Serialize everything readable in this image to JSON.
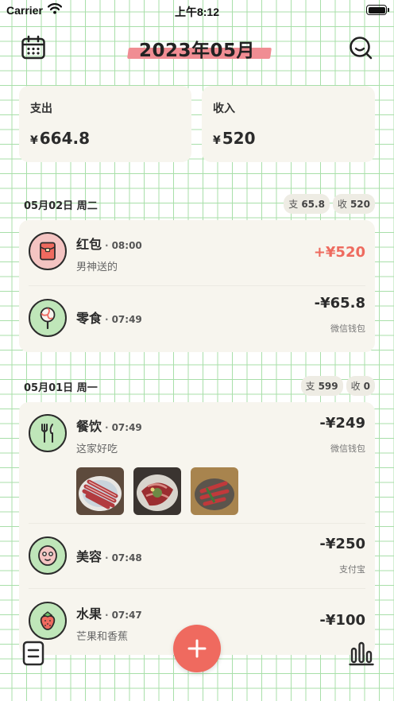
{
  "status_bar": {
    "carrier": "Carrier",
    "time": "上午8:12"
  },
  "header": {
    "month_title": "2023年05月"
  },
  "summary": {
    "expense_label": "支出",
    "expense_currency": "¥",
    "expense_amount": "664.8",
    "income_label": "收入",
    "income_currency": "¥",
    "income_amount": "520"
  },
  "days": [
    {
      "date": "05月02日 周二",
      "expense_key": "支",
      "expense_total": "65.8",
      "income_key": "收",
      "income_total": "520",
      "transactions": [
        {
          "category": "红包",
          "icon": "red-envelope-icon",
          "time": "08:00",
          "note": "男神送的",
          "amount": "+¥520",
          "account": ""
        },
        {
          "category": "零食",
          "icon": "lollipop-icon",
          "time": "07:49",
          "note": "",
          "amount": "-¥65.8",
          "account": "微信钱包"
        }
      ]
    },
    {
      "date": "05月01日 周一",
      "expense_key": "支",
      "expense_total": "599",
      "income_key": "收",
      "income_total": "0",
      "transactions": [
        {
          "category": "餐饮",
          "icon": "fork-knife-icon",
          "time": "07:49",
          "note": "这家好吃",
          "amount": "-¥249",
          "account": "微信钱包"
        },
        {
          "category": "美容",
          "icon": "face-mask-icon",
          "time": "07:48",
          "note": "",
          "amount": "-¥250",
          "account": "支付宝"
        },
        {
          "category": "水果",
          "icon": "strawberry-icon",
          "time": "07:47",
          "note": "芒果和香蕉",
          "amount": "-¥100",
          "account": ""
        }
      ]
    }
  ],
  "colors": {
    "grid_line": "#a8dfa9",
    "card_bg": "#f7f5ee",
    "accent_red": "#ef6a5f",
    "income_red": "#ee6b5f",
    "title_highlight": "#f08d93",
    "icon_pink_bg": "#f4c4c2",
    "icon_green_bg": "#bfe6b9"
  },
  "icons": {
    "calendar": "calendar-icon",
    "search": "search-smile-icon",
    "bottom_left": "list-icon",
    "bottom_right": "bar-chart-icon",
    "fab": "plus-icon"
  }
}
